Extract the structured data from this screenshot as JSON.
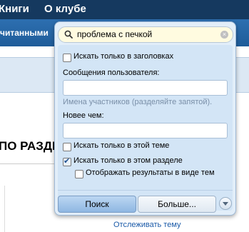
{
  "nav": {
    "books": "Книги",
    "about": "О клубе"
  },
  "subnav": {
    "label": "читанными"
  },
  "page": {
    "section_title": "ПО РАЗДЕ",
    "follow_link": "Отслеживать тему"
  },
  "search": {
    "query": "проблема с печкой",
    "title_only_label": "Искать только в заголовках",
    "user_messages_label": "Сообщения пользователя:",
    "user_hint": "Имена участников (разделяйте запятой).",
    "newer_than_label": "Новее чем:",
    "this_topic_label": "Искать только в этой теме",
    "this_section_label": "Искать только в этом разделе",
    "as_topics_label": "Отображать результаты в виде тем",
    "search_button": "Поиск",
    "more_button": "Больше...",
    "checks": {
      "title_only": false,
      "this_topic": false,
      "this_section": true,
      "as_topics": false
    }
  }
}
